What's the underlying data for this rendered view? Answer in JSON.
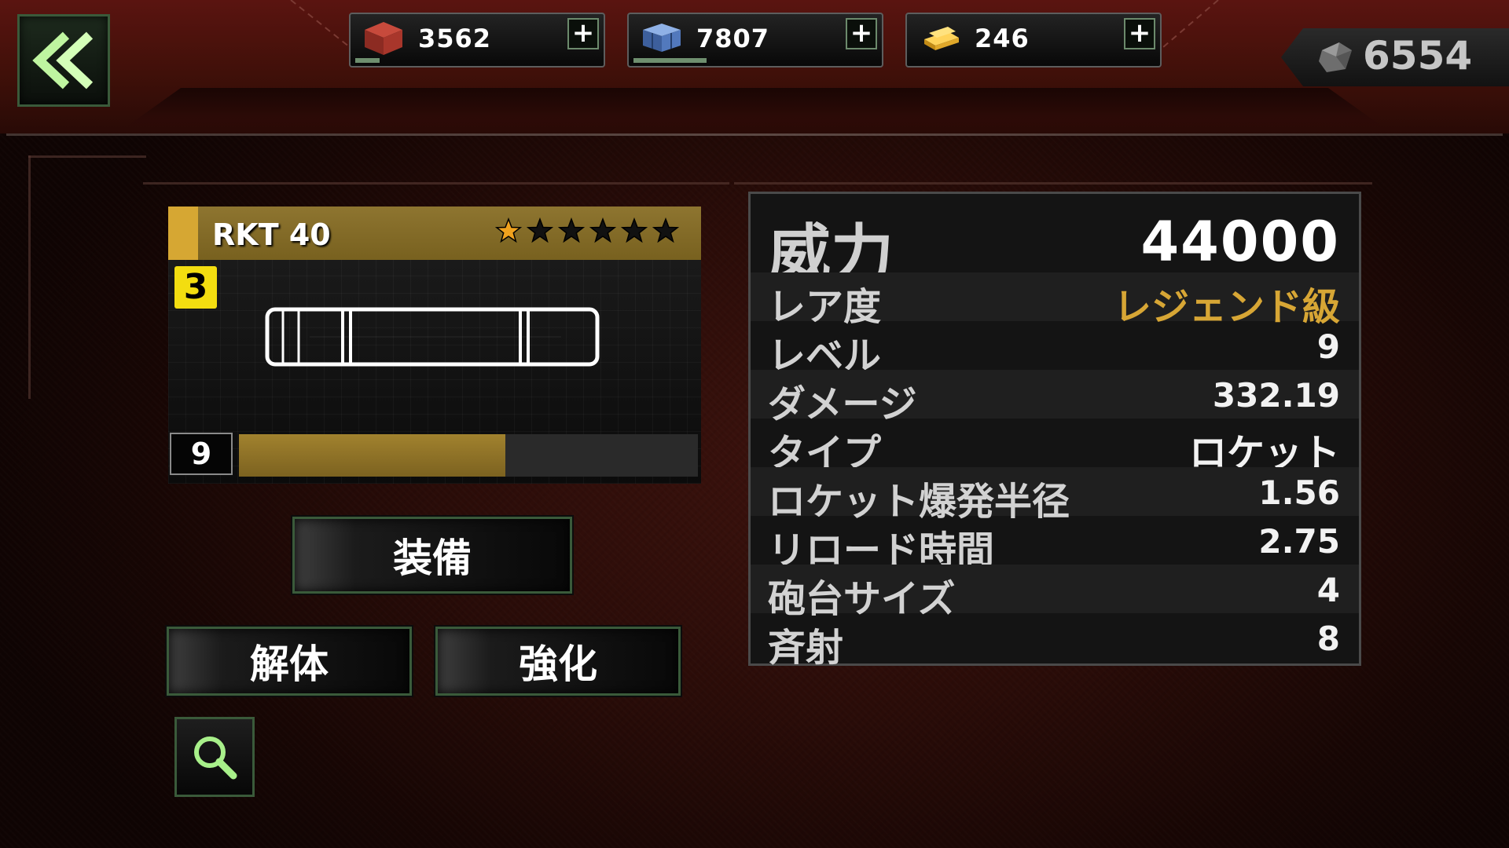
{
  "resources": [
    {
      "icon": "red-block-icon",
      "value": "3562",
      "progress": 0.1
    },
    {
      "icon": "blue-block-icon",
      "value": "7807",
      "progress": 0.3
    },
    {
      "icon": "gold-bar-icon",
      "value": "246",
      "progress": 0
    }
  ],
  "resource_plus_label": "+",
  "currency": {
    "icon": "gem-icon",
    "value": "6554"
  },
  "item": {
    "name": "RKT 40",
    "tier": "3",
    "stars_total": 6,
    "stars_filled": 1,
    "level": "9",
    "xp_progress": 0.58
  },
  "buttons": {
    "equip": "装備",
    "dismantle": "解体",
    "upgrade": "強化"
  },
  "stats": {
    "power_label": "威力",
    "power_value": "44000",
    "rows": [
      {
        "label": "レア度",
        "value": "レジェンド級"
      },
      {
        "label": "レベル",
        "value": "9"
      },
      {
        "label": "ダメージ",
        "value": "332.19"
      },
      {
        "label": "タイプ",
        "value": "ロケット"
      },
      {
        "label": "ロケット爆発半径",
        "value": "1.56"
      },
      {
        "label": "リロード時間",
        "value": "2.75"
      },
      {
        "label": "砲台サイズ",
        "value": "4"
      },
      {
        "label": "斉射",
        "value": "8"
      }
    ]
  },
  "colors": {
    "accent_green": "#3a5a3a",
    "rarity_legend": "#d7a635",
    "star_filled": "#f0a21e",
    "xp_fill": "#a1822e"
  }
}
